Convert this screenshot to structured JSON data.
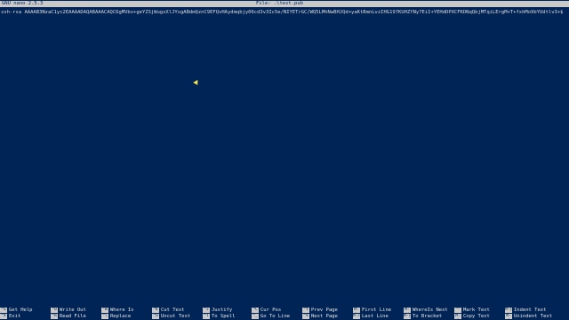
{
  "titlebar": {
    "version": "GNU nano 2.5.3",
    "file_label": "File: .\\test.pub"
  },
  "editor": {
    "line1": "ssh-rsa AAAAB3NzaC1yc2EAAAADAQABAAACAQC6gMVbx+geYZSjWugsXlJYxgABdmQznC9EFQvHAydmqbjy06cd3v3Ic5e/NIYETrGC/WQ5LMhNwBHJQd+yaKtBmnLvzIHG197KUHZYNy7EiI+YEHdDPXCFKDNqQbjMTqiLErgM+T+fxhMo9bYUdtlv3+$"
  },
  "shortcuts": {
    "row1": [
      {
        "key": "^G",
        "label": "Get Help"
      },
      {
        "key": "^O",
        "label": "Write Out"
      },
      {
        "key": "^W",
        "label": "Where Is"
      },
      {
        "key": "^K",
        "label": "Cut Text"
      },
      {
        "key": "^J",
        "label": "Justify"
      },
      {
        "key": "^C",
        "label": "Cur Pos"
      },
      {
        "key": "^Y",
        "label": "Prev Page"
      },
      {
        "key": "M-\\",
        "label": "First Line"
      },
      {
        "key": "M-W",
        "label": "WhereIs Next"
      },
      {
        "key": "^^",
        "label": "Mark Text"
      },
      {
        "key": "M-}",
        "label": "Indent Text"
      }
    ],
    "row2": [
      {
        "key": "^X",
        "label": "Exit"
      },
      {
        "key": "^R",
        "label": "Read File"
      },
      {
        "key": "^\\",
        "label": "Replace"
      },
      {
        "key": "^U",
        "label": "Uncut Text"
      },
      {
        "key": "^T",
        "label": "To Spell"
      },
      {
        "key": "^_",
        "label": "Go To Line"
      },
      {
        "key": "^V",
        "label": "Next Page"
      },
      {
        "key": "M-/",
        "label": "Last Line"
      },
      {
        "key": "M-]",
        "label": "To Bracket"
      },
      {
        "key": "M-6",
        "label": "Copy Text"
      },
      {
        "key": "M-{",
        "label": "Unindent Text"
      }
    ]
  },
  "colors": {
    "background": "#012456",
    "bar": "#c9c9c9",
    "text": "#e6e6e6",
    "pointer": "#f7e74b"
  }
}
